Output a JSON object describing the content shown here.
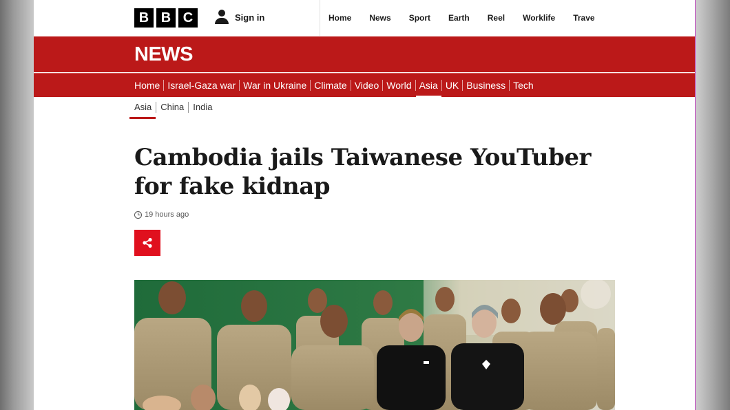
{
  "header": {
    "logo_letters": [
      "B",
      "B",
      "C"
    ],
    "signin_label": "Sign in",
    "nav": [
      "Home",
      "News",
      "Sport",
      "Earth",
      "Reel",
      "Worklife",
      "Trave"
    ]
  },
  "banner": {
    "title": "NEWS",
    "sections": [
      "Home",
      "Israel-Gaza war",
      "War in Ukraine",
      "Climate",
      "Video",
      "World",
      "Asia",
      "UK",
      "Business",
      "Tech"
    ],
    "active_section": "Asia"
  },
  "subnav": {
    "items": [
      "Asia",
      "China",
      "India"
    ],
    "active": "Asia"
  },
  "article": {
    "headline": "Cambodia jails Taiwanese YouTuber for fake kidnap",
    "timestamp": "19 hours ago",
    "share_icon": "share-icon",
    "image_description_icon": "photo"
  },
  "colors": {
    "brand_red": "#bb1919",
    "share_red": "#e0101e",
    "text": "#1a1a1a"
  }
}
